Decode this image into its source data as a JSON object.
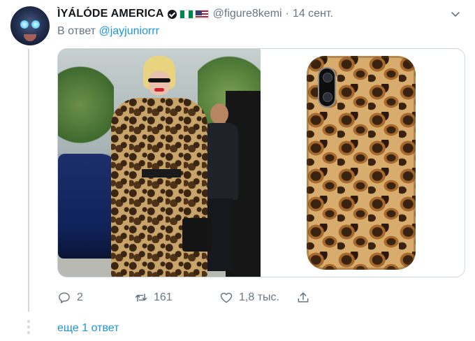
{
  "tweet": {
    "author_name": "ÌYÁLÓDE AMERICA",
    "handle": "@figure8kemi",
    "separator": "·",
    "timestamp": "14 сент.",
    "reply_prefix": "В ответ",
    "reply_to": "@jayjuniorrr",
    "flags": [
      "flag-nigeria",
      "flag-usa"
    ],
    "media": [
      "street-photo",
      "leopard-phone-case"
    ]
  },
  "actions": {
    "reply_count": "2",
    "retweet_count": "161",
    "like_count": "1,8 тыс."
  },
  "thread": {
    "more_replies": "еще 1 ответ"
  },
  "colors": {
    "link": "#1b95e0",
    "muted": "#657786",
    "text": "#14171a",
    "border": "#ccd6dd"
  }
}
